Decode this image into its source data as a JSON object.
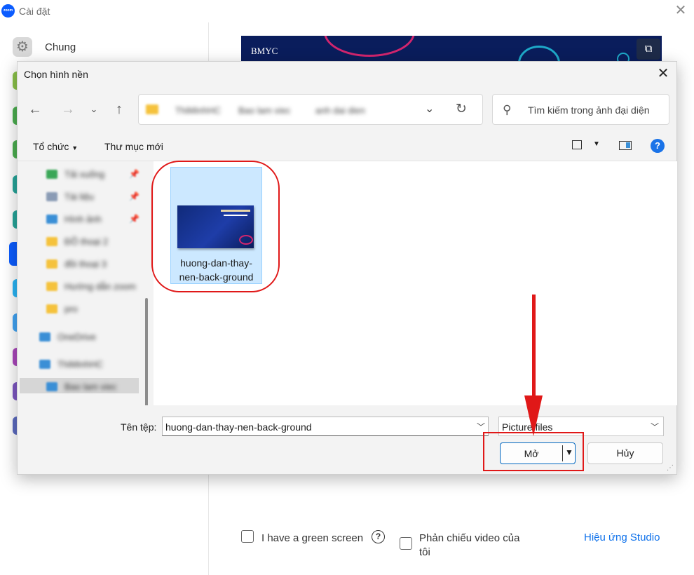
{
  "zoom": {
    "title": "Cài đặt",
    "logo_text": "zoom",
    "sidebar_first": "Chung",
    "preview_logo": "BMYC",
    "green_screen_label": "I have a green screen",
    "mirror_label": "Phản chiếu video của tôi",
    "studio_link": "Hiệu ứng Studio",
    "side_stub_colors": [
      "#8bc34a",
      "#4caf50",
      "#4caf50",
      "#26a69a",
      "#26a69a",
      "#0b5cff",
      "#29b6f6",
      "#42a5f5",
      "#ab47bc",
      "#7e57c2",
      "#5c6bc0"
    ]
  },
  "dialog": {
    "title": "Chọn hình nền",
    "address_crumbs": [
      "ThiMinhHC",
      "Bao lam viec",
      "anh dai dien"
    ],
    "search_placeholder": "Tìm kiếm trong ảnh đại diện",
    "toolbar": {
      "organize": "Tổ chức",
      "new_folder": "Thư mục mới"
    },
    "nav_items": [
      {
        "label": "Tải xuống",
        "icon_color": "#3aa757",
        "pinned": true
      },
      {
        "label": "Tài liệu",
        "icon_color": "#8a9bb5",
        "pinned": true
      },
      {
        "label": "Hình ảnh",
        "icon_color": "#3a8fd6",
        "pinned": true
      },
      {
        "label": "ĐỒ thoại 2",
        "icon_color": "#f5c23c",
        "pinned": false
      },
      {
        "label": "đồi thoại 3",
        "icon_color": "#f5c23c",
        "pinned": false
      },
      {
        "label": "Hướng dẫn zoom",
        "icon_color": "#f5c23c",
        "pinned": false
      },
      {
        "label": "pro",
        "icon_color": "#f5c23c",
        "pinned": false
      },
      {
        "label": "OneDrive",
        "icon_color": "#3a8fd6",
        "pinned": false
      },
      {
        "label": "ThiMinhHC",
        "icon_color": "#3a8fd6",
        "pinned": false
      },
      {
        "label": "Bao lam viec",
        "icon_color": "#3a8fd6",
        "pinned": false
      }
    ],
    "file": {
      "name_line1": "huong-dan-thay-",
      "name_line2": "nen-back-ground"
    },
    "filename_label": "Tên tệp:",
    "filename_value": "huong-dan-thay-nen-back-ground",
    "filetype_value": "Picture files",
    "open_label": "Mở",
    "cancel_label": "Hủy"
  }
}
